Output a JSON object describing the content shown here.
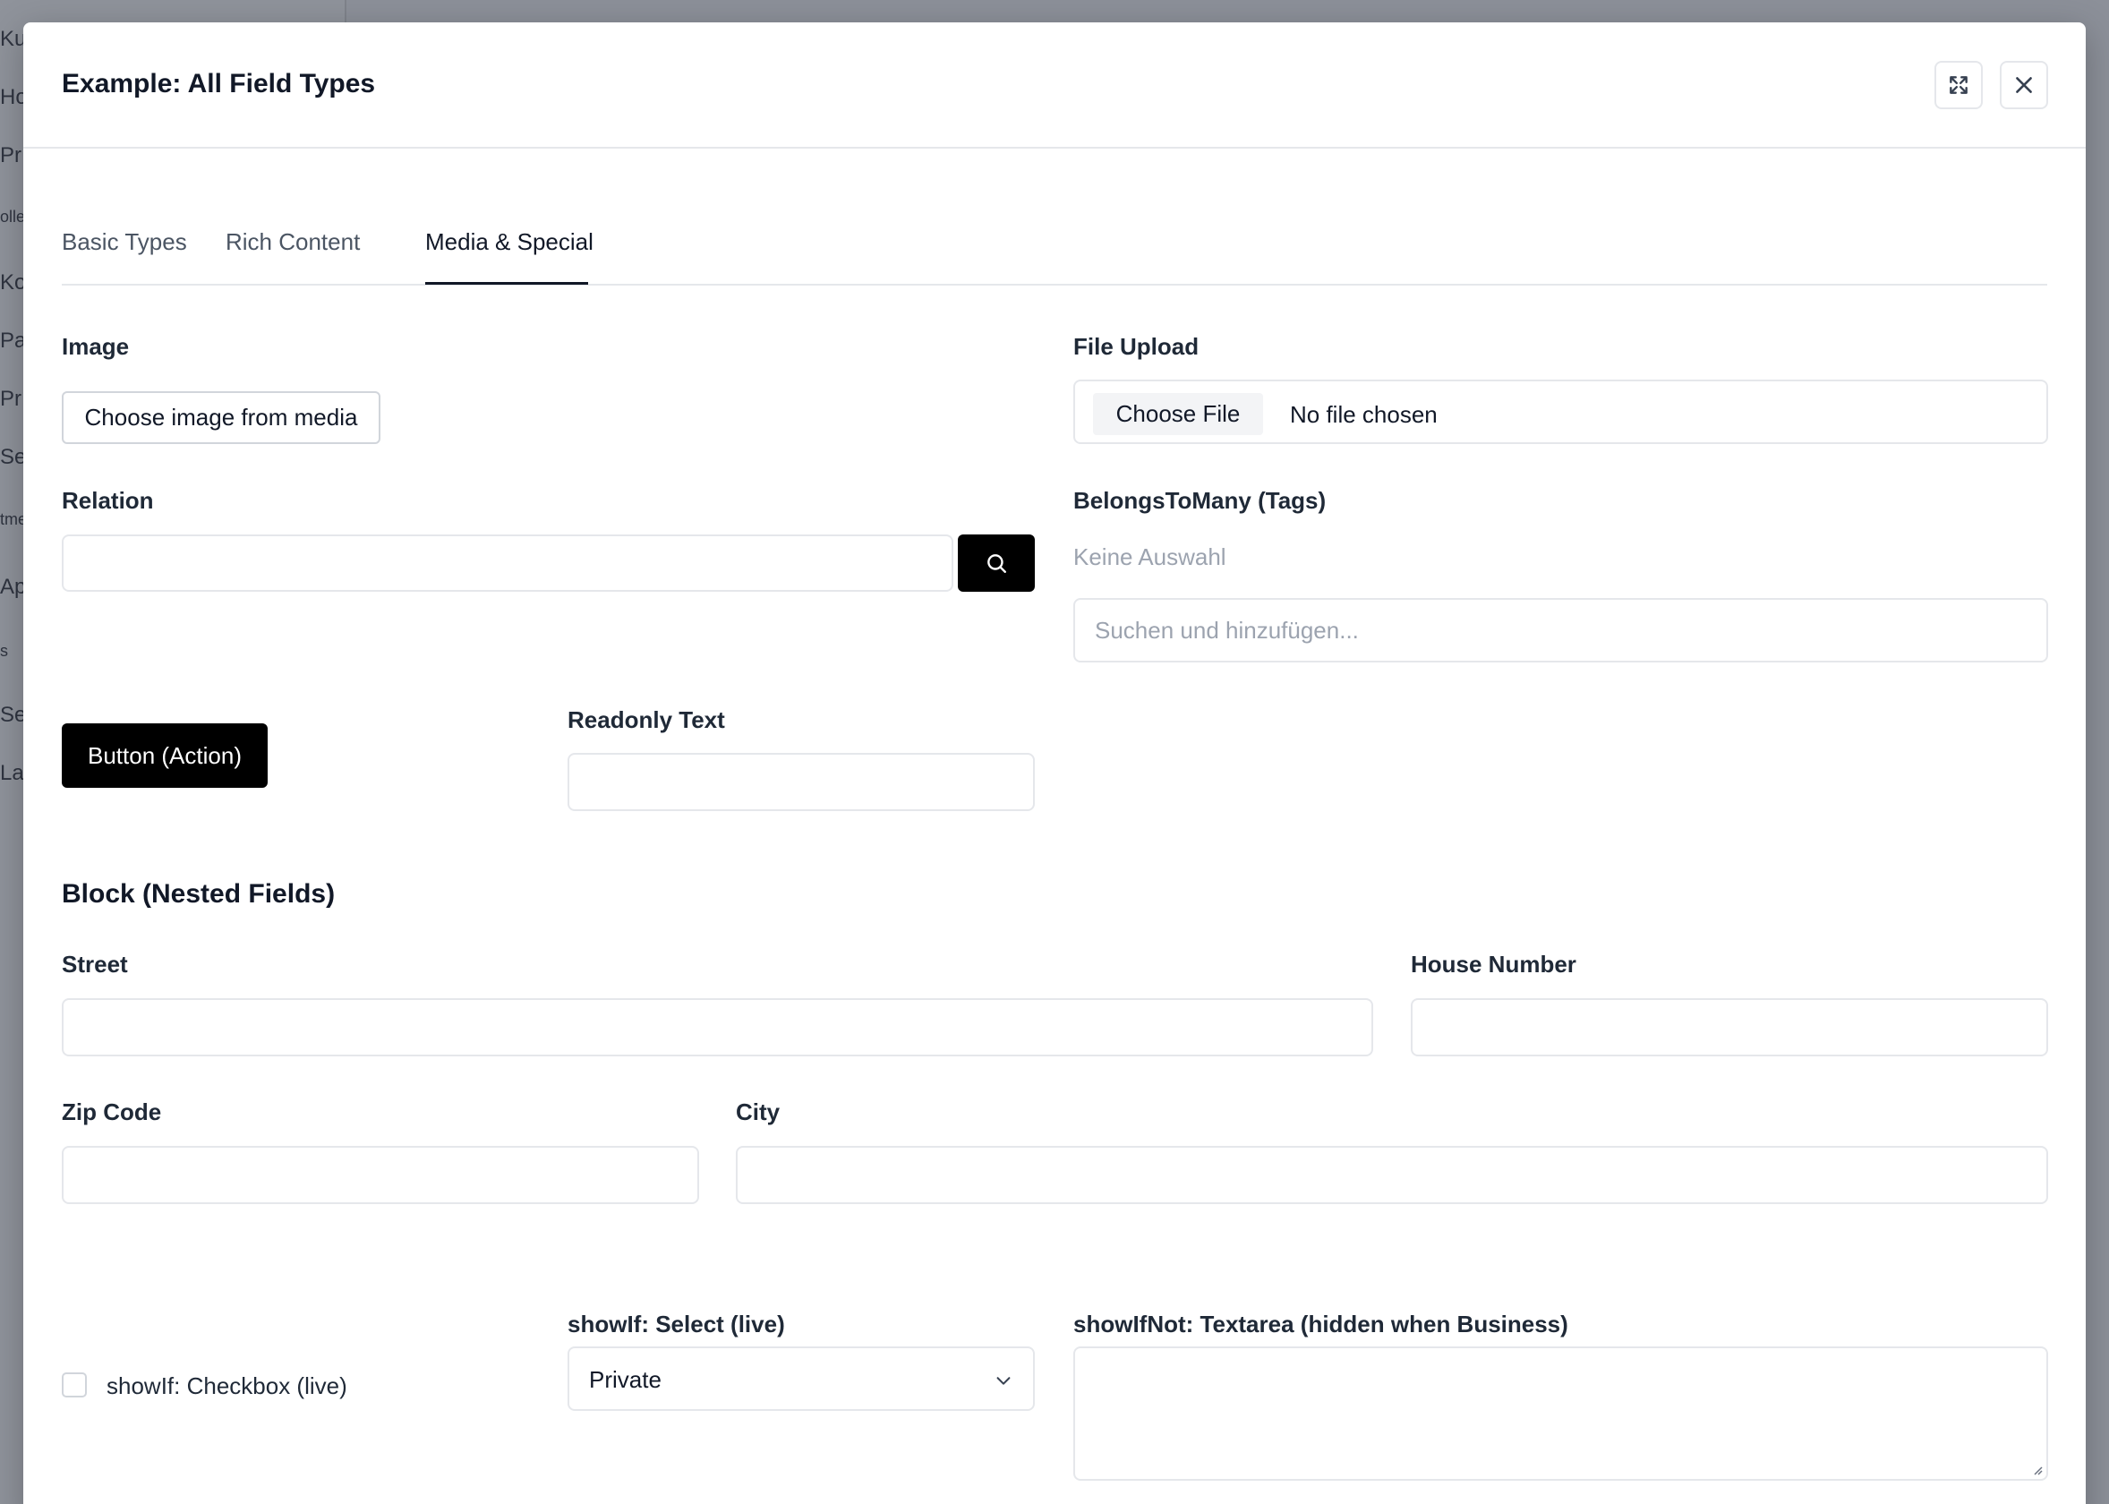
{
  "background": {
    "sidebar_items": [
      {
        "label": "Ku",
        "small": false
      },
      {
        "label": "Ho",
        "small": false
      },
      {
        "label": "Pr",
        "small": false
      },
      {
        "label": "olle",
        "small": true
      },
      {
        "label": "Ko",
        "small": false
      },
      {
        "label": "Pa",
        "small": false
      },
      {
        "label": "Pr",
        "small": false
      },
      {
        "label": "Se",
        "small": false
      },
      {
        "label": "tme",
        "small": true
      },
      {
        "label": "Ap",
        "small": false
      },
      {
        "label": "s",
        "small": true
      },
      {
        "label": "Se",
        "small": false
      },
      {
        "label": "La",
        "small": false
      }
    ]
  },
  "modal": {
    "title": "Example: All Field Types"
  },
  "tabs": [
    {
      "label": "Basic Types",
      "active": false
    },
    {
      "label": "Rich Content",
      "active": false
    },
    {
      "label": "Media & Special",
      "active": true
    }
  ],
  "fields": {
    "image": {
      "label": "Image",
      "button": "Choose image from media"
    },
    "file_upload": {
      "label": "File Upload",
      "button": "Choose File",
      "status": "No file chosen"
    },
    "relation": {
      "label": "Relation",
      "value": ""
    },
    "tags": {
      "label": "BelongsToMany (Tags)",
      "empty_text": "Keine Auswahl",
      "placeholder": "Suchen und hinzufügen..."
    },
    "action_button": {
      "label": "Button (Action)"
    },
    "readonly": {
      "label": "Readonly Text",
      "value": ""
    }
  },
  "block": {
    "title": "Block (Nested Fields)",
    "street": {
      "label": "Street",
      "value": ""
    },
    "house_number": {
      "label": "House Number",
      "value": ""
    },
    "zip": {
      "label": "Zip Code",
      "value": ""
    },
    "city": {
      "label": "City",
      "value": ""
    }
  },
  "conditional": {
    "checkbox": {
      "label": "showIf: Checkbox (live)",
      "checked": false
    },
    "select": {
      "label": "showIf: Select (live)",
      "value": "Private"
    },
    "textarea": {
      "label": "showIfNot: Textarea (hidden when Business)",
      "value": ""
    }
  }
}
